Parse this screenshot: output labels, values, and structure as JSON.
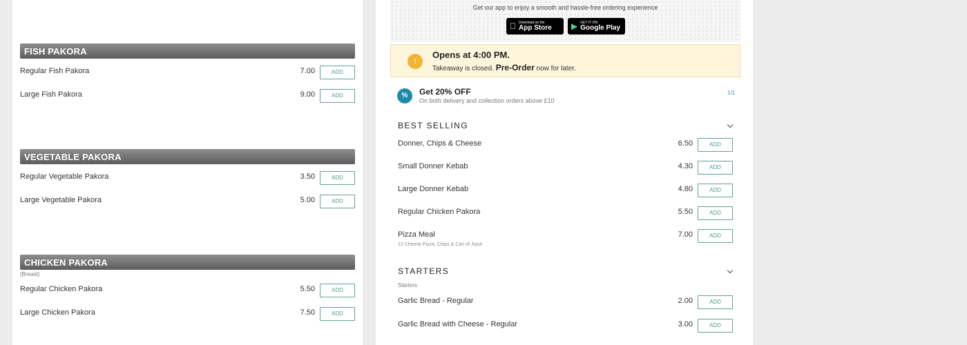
{
  "left_menu": {
    "categories": [
      {
        "title": "FISH PAKORA",
        "note": "",
        "items": [
          {
            "name": "Regular Fish Pakora",
            "price": "7.00",
            "button": "ADD"
          },
          {
            "name": "Large Fish Pakora",
            "price": "9.00",
            "button": "ADD"
          }
        ]
      },
      {
        "title": "VEGETABLE PAKORA",
        "note": "",
        "items": [
          {
            "name": "Regular Vegetable Pakora",
            "price": "3.50",
            "button": "ADD"
          },
          {
            "name": "Large Vegetable Pakora",
            "price": "5.00",
            "button": "ADD"
          }
        ]
      },
      {
        "title": "CHICKEN PAKORA",
        "note": "(Breast)",
        "items": [
          {
            "name": "Regular Chicken Pakora",
            "price": "5.50",
            "button": "ADD"
          },
          {
            "name": "Large Chicken Pakora",
            "price": "7.50",
            "button": "ADD"
          }
        ]
      }
    ]
  },
  "app_banner": {
    "text": "Get our app to enjoy a smooth and hassle-free ordering experience",
    "app_store": {
      "small": "Download on the",
      "big": "App Store"
    },
    "google_play": {
      "small": "GET IT ON",
      "big": "Google Play"
    }
  },
  "opening": {
    "title": "Opens at 4:00 PM.",
    "status_text": "Takeaway is closed.",
    "preorder": "Pre-Order",
    "suffix": "now for later.",
    "icon": "info-icon"
  },
  "promo": {
    "title": "Get 20% OFF",
    "subtitle": "On both delivery and collection orders above £10",
    "counter": "1/1",
    "icon": "discount-badge-icon",
    "icon_glyph": "%"
  },
  "best_selling": {
    "title": "BEST SELLING",
    "items": [
      {
        "name": "Donner, Chips & Cheese",
        "price": "6.50",
        "button": "ADD",
        "desc": ""
      },
      {
        "name": "Small Donner Kebab",
        "price": "4.30",
        "button": "ADD",
        "desc": ""
      },
      {
        "name": "Large Donner Kebab",
        "price": "4.80",
        "button": "ADD",
        "desc": ""
      },
      {
        "name": "Regular Chicken Pakora",
        "price": "5.50",
        "button": "ADD",
        "desc": ""
      },
      {
        "name": "Pizza Meal",
        "price": "7.00",
        "button": "ADD",
        "desc": "12 Cheese Pizza, Chips & Can of Juice"
      }
    ]
  },
  "starters": {
    "title": "STARTERS",
    "subtitle": "Starters",
    "items": [
      {
        "name": "Garlic Bread - Regular",
        "price": "2.00",
        "button": "ADD"
      },
      {
        "name": "Garlic Bread with Cheese - Regular",
        "price": "3.00",
        "button": "ADD"
      }
    ]
  },
  "colors": {
    "accent_green": "#4e9e8e",
    "notice_yellow": "#f2b531",
    "promo_blue": "#1d8aa8",
    "category_bar": "#6f6f6f"
  }
}
